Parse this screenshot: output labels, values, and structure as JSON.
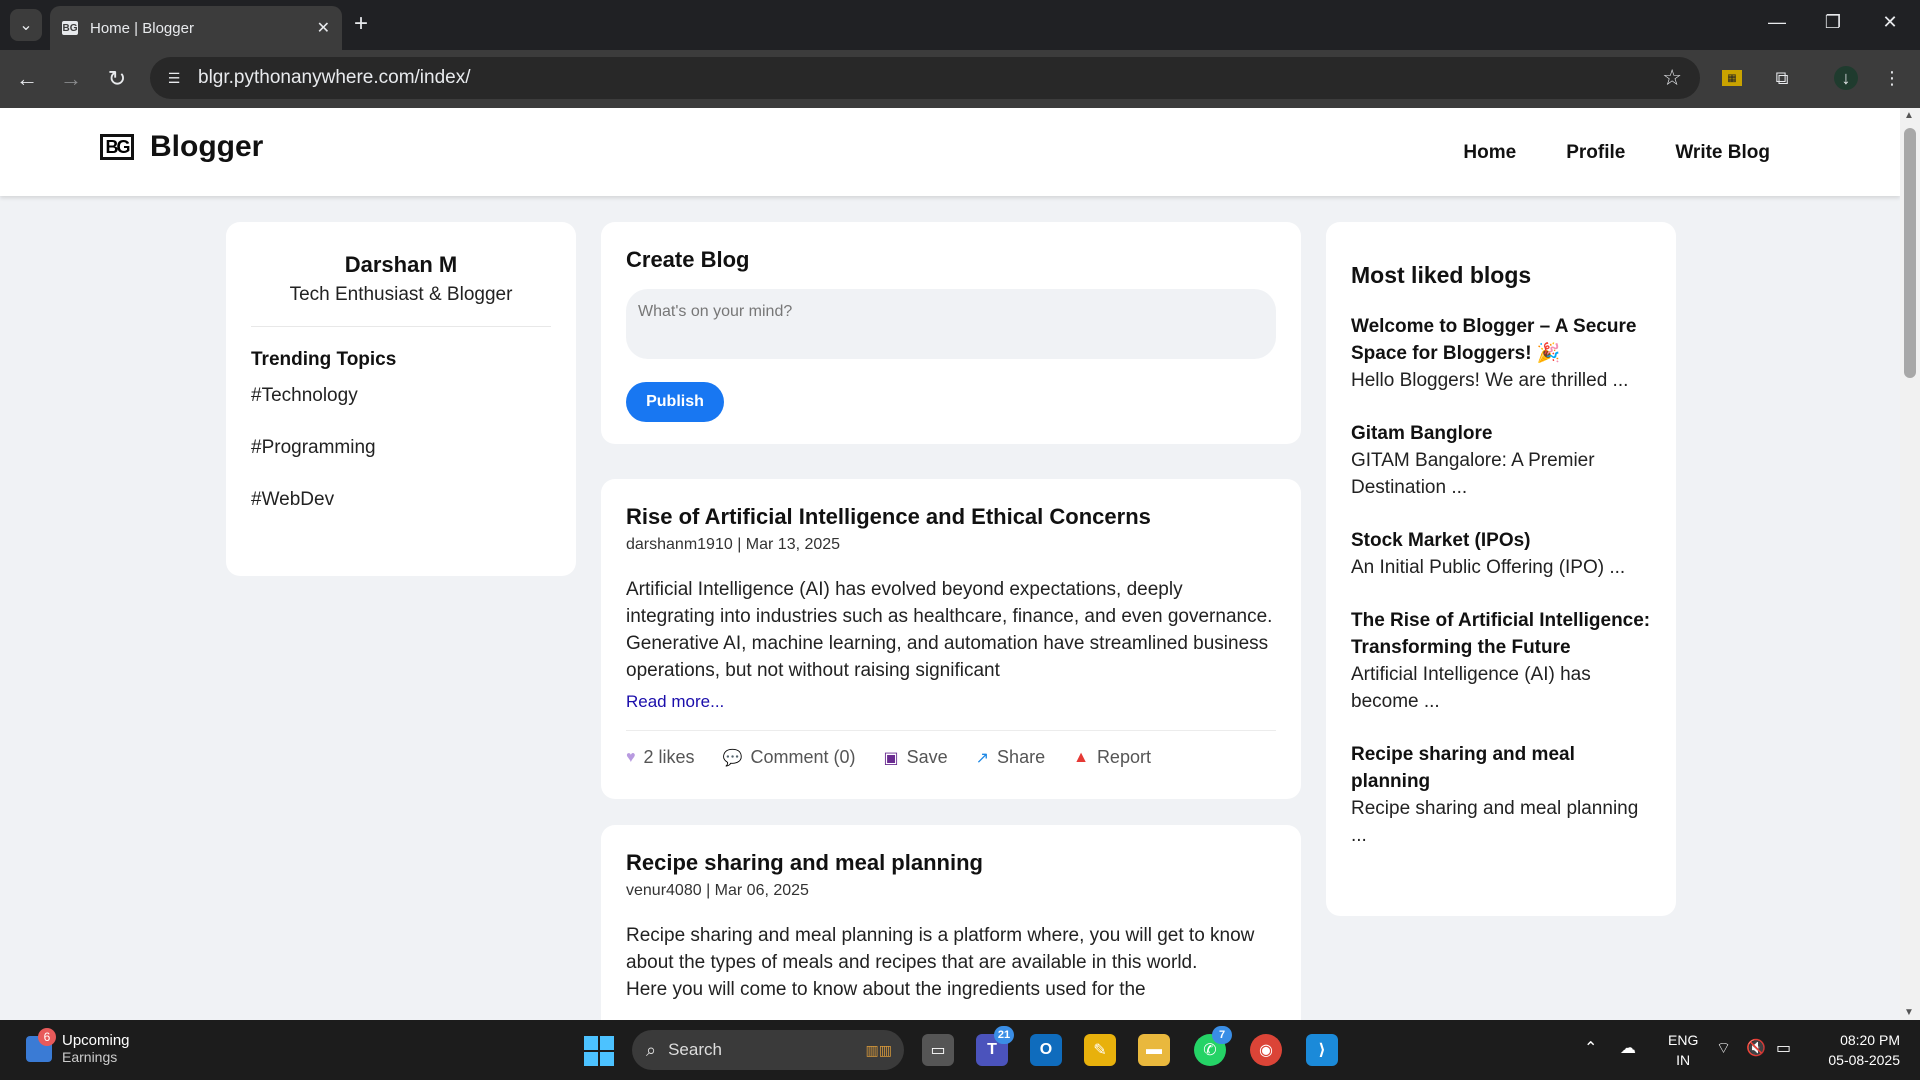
{
  "browser": {
    "tab_title": "Home | Blogger",
    "tab_favicon": "BG",
    "url": "blgr.pythonanywhere.com/index/"
  },
  "header": {
    "logo_mark": "BG",
    "site_name": "Blogger",
    "nav": [
      "Home",
      "Profile",
      "Write Blog"
    ]
  },
  "profile": {
    "name": "Darshan M",
    "title": "Tech Enthusiast & Blogger",
    "trending_heading": "Trending Topics",
    "topics": [
      "#Technology",
      "#Programming",
      "#WebDev"
    ]
  },
  "create": {
    "heading": "Create Blog",
    "placeholder": "What's on your mind?",
    "publish_label": "Publish"
  },
  "posts": [
    {
      "title": "Rise of Artificial Intelligence and Ethical Concerns",
      "meta": "darshanm1910 | Mar 13, 2025",
      "body": "Artificial Intelligence (AI) has evolved beyond expectations, deeply integrating into industries such as healthcare, finance, and even governance. Generative AI, machine learning, and automation have streamlined business operations, but not without raising significant",
      "read_more": "Read more...",
      "likes": "2 likes",
      "comment": "Comment (0)",
      "save": "Save",
      "share": "Share",
      "report": "Report"
    },
    {
      "title": "Recipe sharing and meal planning",
      "meta": "venur4080 | Mar 06, 2025",
      "body_line1": "Recipe sharing and meal planning is a platform where, you will get to know about the types of meals and recipes that are available in this world.",
      "body_line2": "Here you will come to know about the ingredients used for the"
    }
  ],
  "most_liked": {
    "heading": "Most liked blogs",
    "items": [
      {
        "title": "Welcome to Blogger – A Secure Space for Bloggers! 🎉",
        "excerpt": "Hello Bloggers! We are thrilled ..."
      },
      {
        "title": "Gitam Banglore",
        "excerpt": "GITAM Bangalore: A Premier Destination ..."
      },
      {
        "title": "Stock Market (IPOs)",
        "excerpt": "An Initial Public Offering (IPO) ..."
      },
      {
        "title": "The Rise of Artificial Intelligence: Transforming the Future",
        "excerpt": "Artificial Intelligence (AI) has become ..."
      },
      {
        "title": "Recipe sharing and meal planning",
        "excerpt": "Recipe sharing and meal planning ..."
      }
    ]
  },
  "taskbar": {
    "widget_badge": "6",
    "widget_line1": "Upcoming",
    "widget_line2": "Earnings",
    "search_label": "Search",
    "teams_badge": "21",
    "whatsapp_badge": "7",
    "lang_line1": "ENG",
    "lang_line2": "IN",
    "time": "08:20 PM",
    "date": "05-08-2025"
  },
  "colors": {
    "accent": "#1877f2",
    "page_bg": "#f0f2f5",
    "link": "#1a0dab"
  }
}
